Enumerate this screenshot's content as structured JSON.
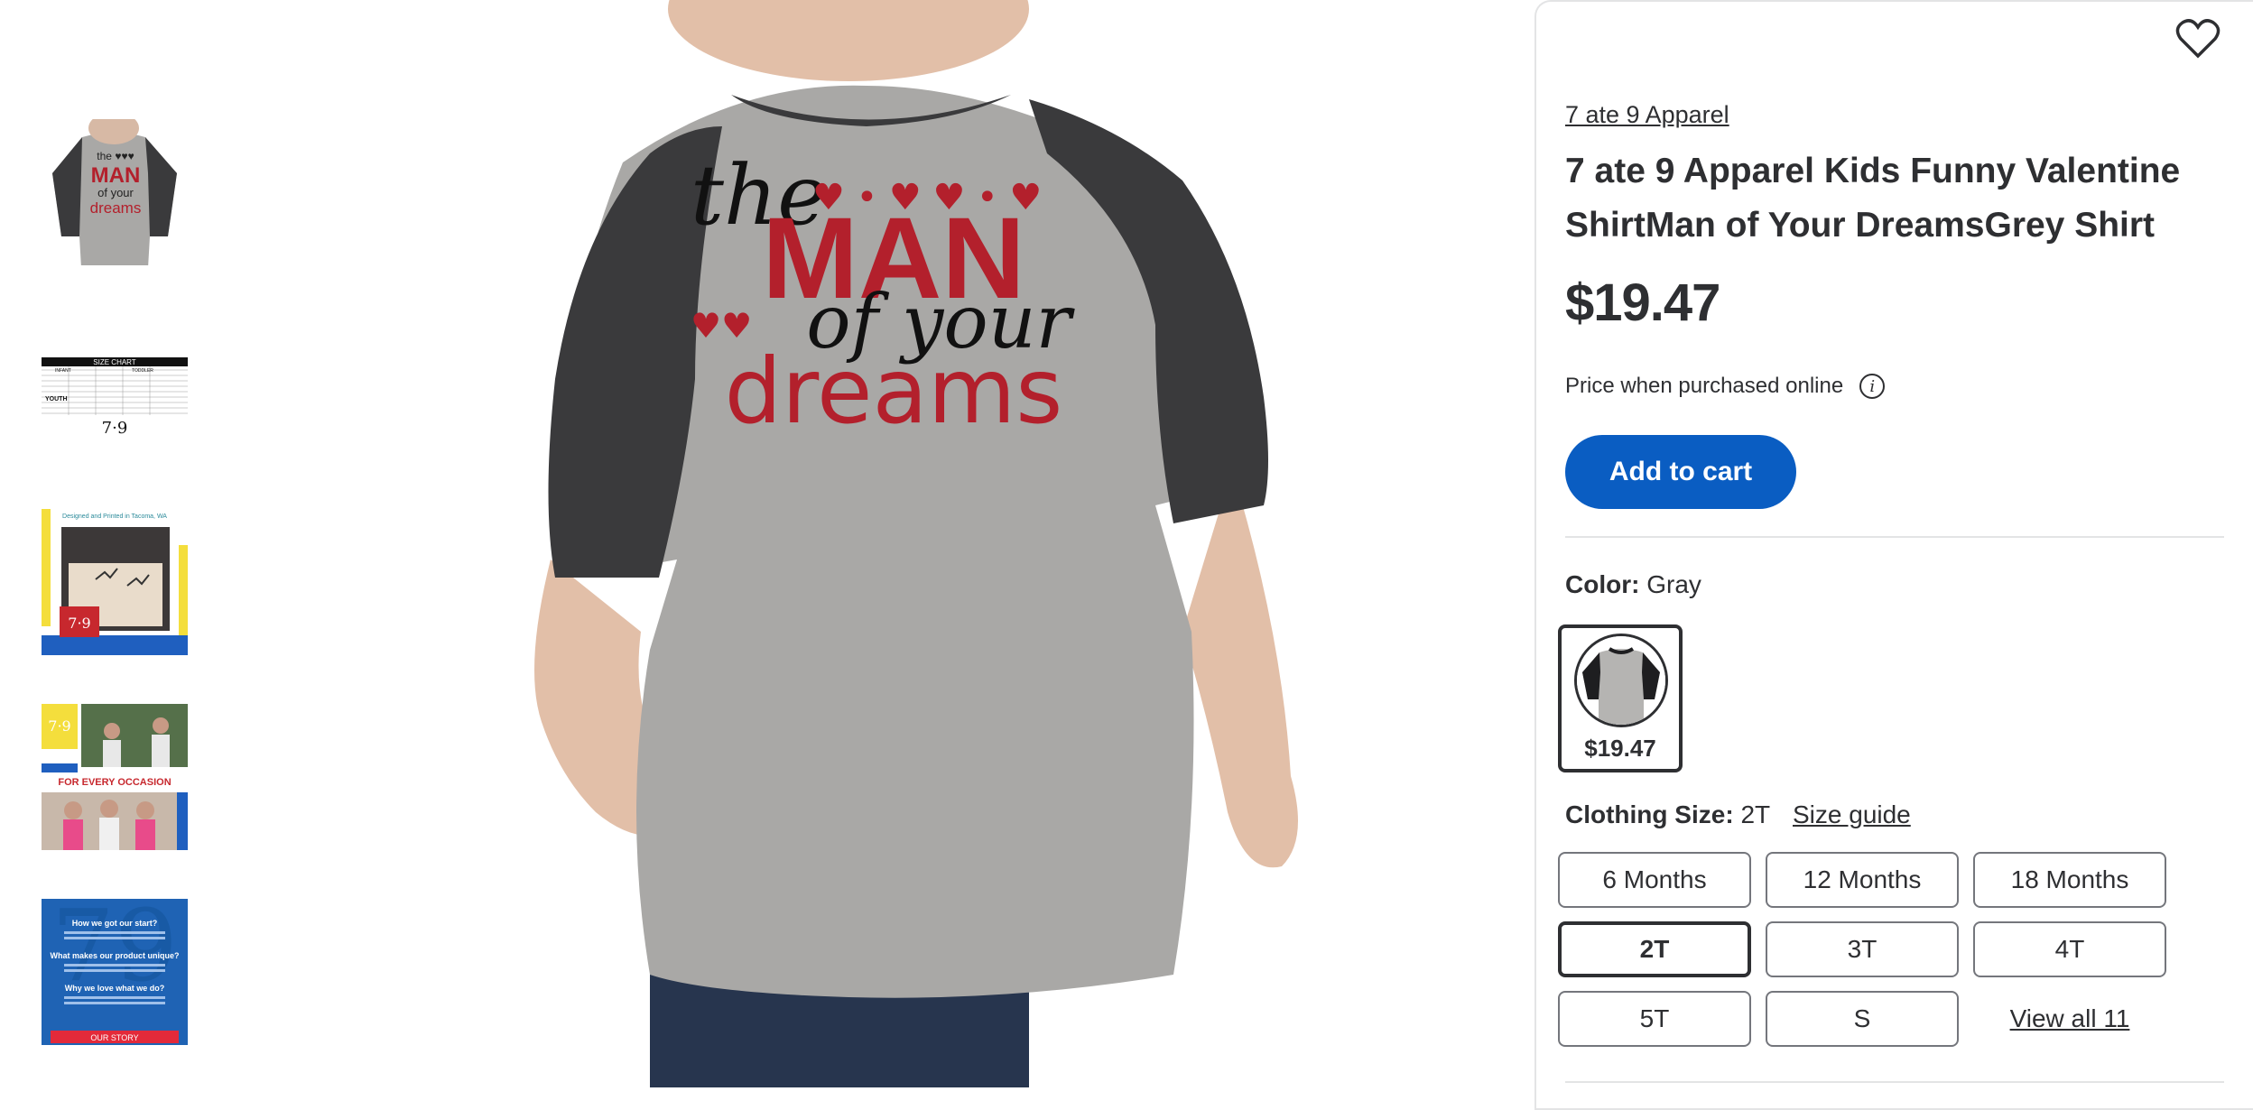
{
  "product": {
    "brand": "7 ate 9 Apparel",
    "title": "7 ate 9 Apparel Kids Funny Valentine ShirtMan of Your DreamsGrey Shirt",
    "price": "$19.47",
    "price_note": "Price when purchased online",
    "add_to_cart": "Add to cart",
    "shirt_print": {
      "line1": "the",
      "line2": "MAN",
      "line3": "of your",
      "line4": "dreams"
    }
  },
  "thumbnails": [
    {
      "name": "shirt-front",
      "shirt_text": "the MAN of your dreams"
    },
    {
      "name": "size-chart",
      "heading": "SIZE CHART",
      "labels": [
        "INFANT",
        "TODDLER",
        "YOUTH"
      ]
    },
    {
      "name": "designed-in-tacoma",
      "caption": "Designed and Printed in Tacoma, WA"
    },
    {
      "name": "for-every-occasion",
      "caption": "FOR EVERY OCCASION"
    },
    {
      "name": "our-story",
      "lines": [
        "How we got our start?",
        "What makes our product unique?",
        "Why we love what we do?"
      ],
      "footer": "OUR STORY"
    }
  ],
  "logo_text": "7·9",
  "color": {
    "label": "Color:",
    "value": "Gray",
    "swatch_price": "$19.47"
  },
  "size": {
    "label": "Clothing Size:",
    "value": "2T",
    "guide": "Size guide",
    "options": [
      "6 Months",
      "12 Months",
      "18 Months",
      "2T",
      "3T",
      "4T",
      "5T",
      "S"
    ],
    "selected": "2T",
    "view_all": "View all 11"
  },
  "colors": {
    "accent": "#0a5dc2",
    "text": "#2e2f32",
    "shirt_gray": "#a9a8a6",
    "sleeve": "#3a3a3c",
    "print_red": "#b3202c"
  }
}
